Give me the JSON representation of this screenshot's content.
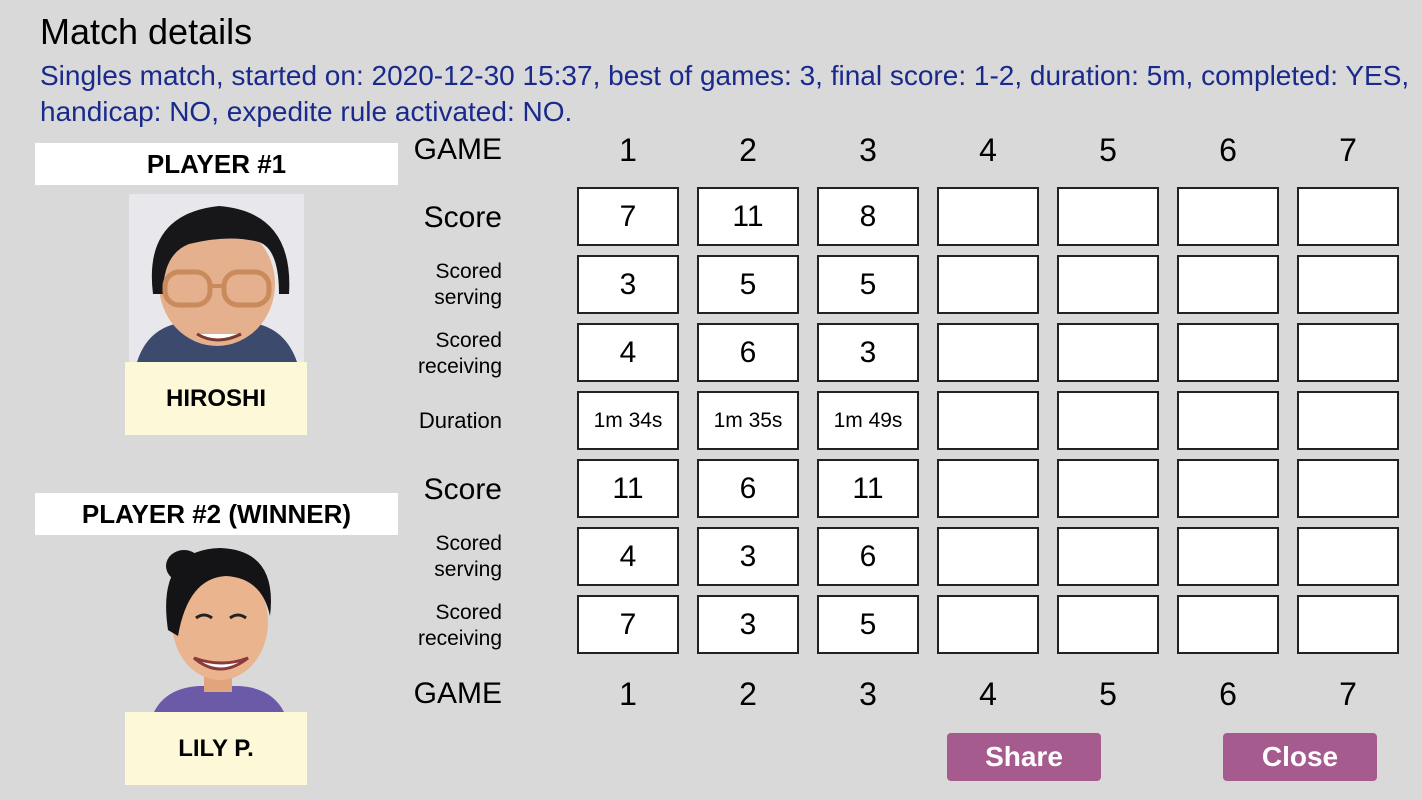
{
  "title": "Match details",
  "summary": "Singles match, started on: 2020-12-30 15:37, best of games: 3, final score: 1-2, duration: 5m, completed: YES, handicap: NO, expedite rule activated: NO.",
  "player1": {
    "header": "PLAYER #1",
    "name": "HIROSHI"
  },
  "player2": {
    "header": "PLAYER #2 (WINNER)",
    "name": "LILY P."
  },
  "table": {
    "game_label": "GAME",
    "games": [
      "1",
      "2",
      "3",
      "4",
      "5",
      "6",
      "7"
    ],
    "row_labels": {
      "score": "Score",
      "scored_serving": "Scored serving",
      "scored_serving_l1": "Scored",
      "scored_serving_l2": "serving",
      "scored_receiving_l1": "Scored",
      "scored_receiving_l2": "receiving",
      "duration": "Duration"
    },
    "p1_score": [
      "7",
      "11",
      "8",
      "",
      "",
      "",
      ""
    ],
    "p1_serving": [
      "3",
      "5",
      "5",
      "",
      "",
      "",
      ""
    ],
    "p1_receiving": [
      "4",
      "6",
      "3",
      "",
      "",
      "",
      ""
    ],
    "duration": [
      "1m 34s",
      "1m 35s",
      "1m 49s",
      "",
      "",
      "",
      ""
    ],
    "p2_score": [
      "11",
      "6",
      "11",
      "",
      "",
      "",
      ""
    ],
    "p2_serving": [
      "4",
      "3",
      "6",
      "",
      "",
      "",
      ""
    ],
    "p2_receiving": [
      "7",
      "3",
      "5",
      "",
      "",
      "",
      ""
    ]
  },
  "buttons": {
    "share": "Share",
    "close": "Close"
  },
  "colors": {
    "summary_text": "#1a2a8c",
    "button": "#a65b8f",
    "name_plate": "#fdf8d8",
    "background": "#d9d9d9"
  }
}
